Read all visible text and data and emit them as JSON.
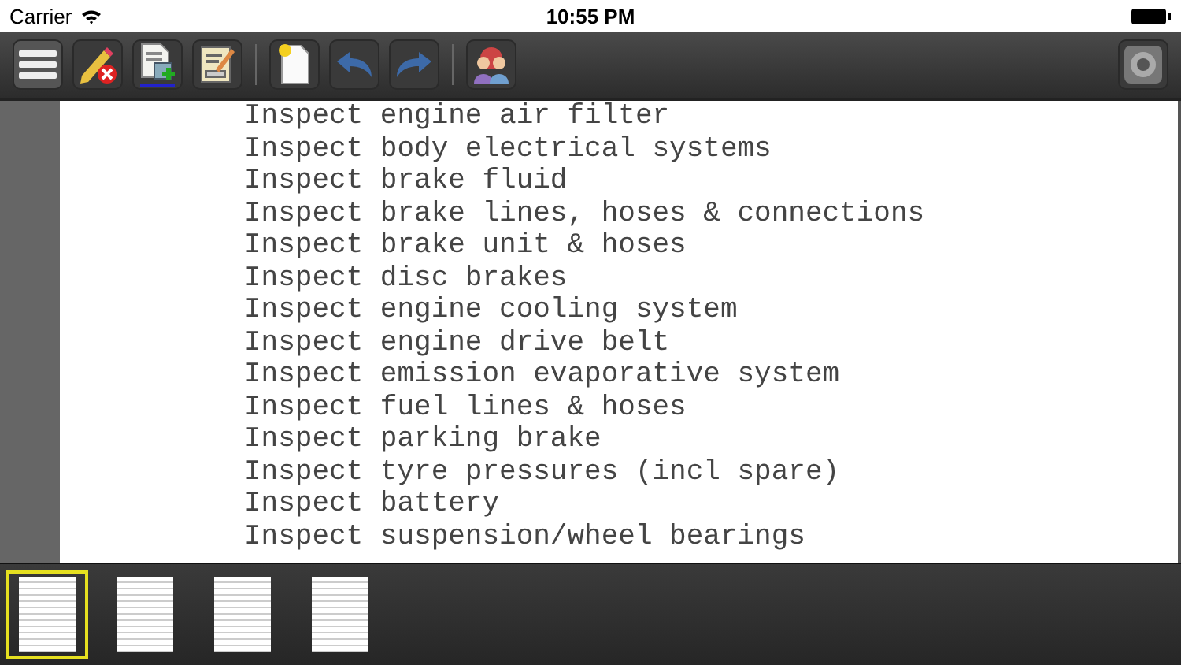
{
  "status_bar": {
    "carrier": "Carrier",
    "time": "10:55 PM"
  },
  "document": {
    "lines": [
      "Inspect engine air filter",
      "Inspect body electrical systems",
      "Inspect brake fluid",
      "Inspect brake lines, hoses & connections",
      "Inspect brake unit & hoses",
      "Inspect disc brakes",
      "Inspect engine cooling system",
      "Inspect engine drive belt",
      "Inspect emission evaporative system",
      "Inspect fuel lines & hoses",
      "Inspect parking brake",
      "Inspect tyre pressures (incl spare)",
      "Inspect battery",
      "Inspect suspension/wheel bearings"
    ]
  },
  "thumbnails": [
    {
      "selected": true
    },
    {
      "selected": false
    },
    {
      "selected": false
    },
    {
      "selected": false
    }
  ]
}
